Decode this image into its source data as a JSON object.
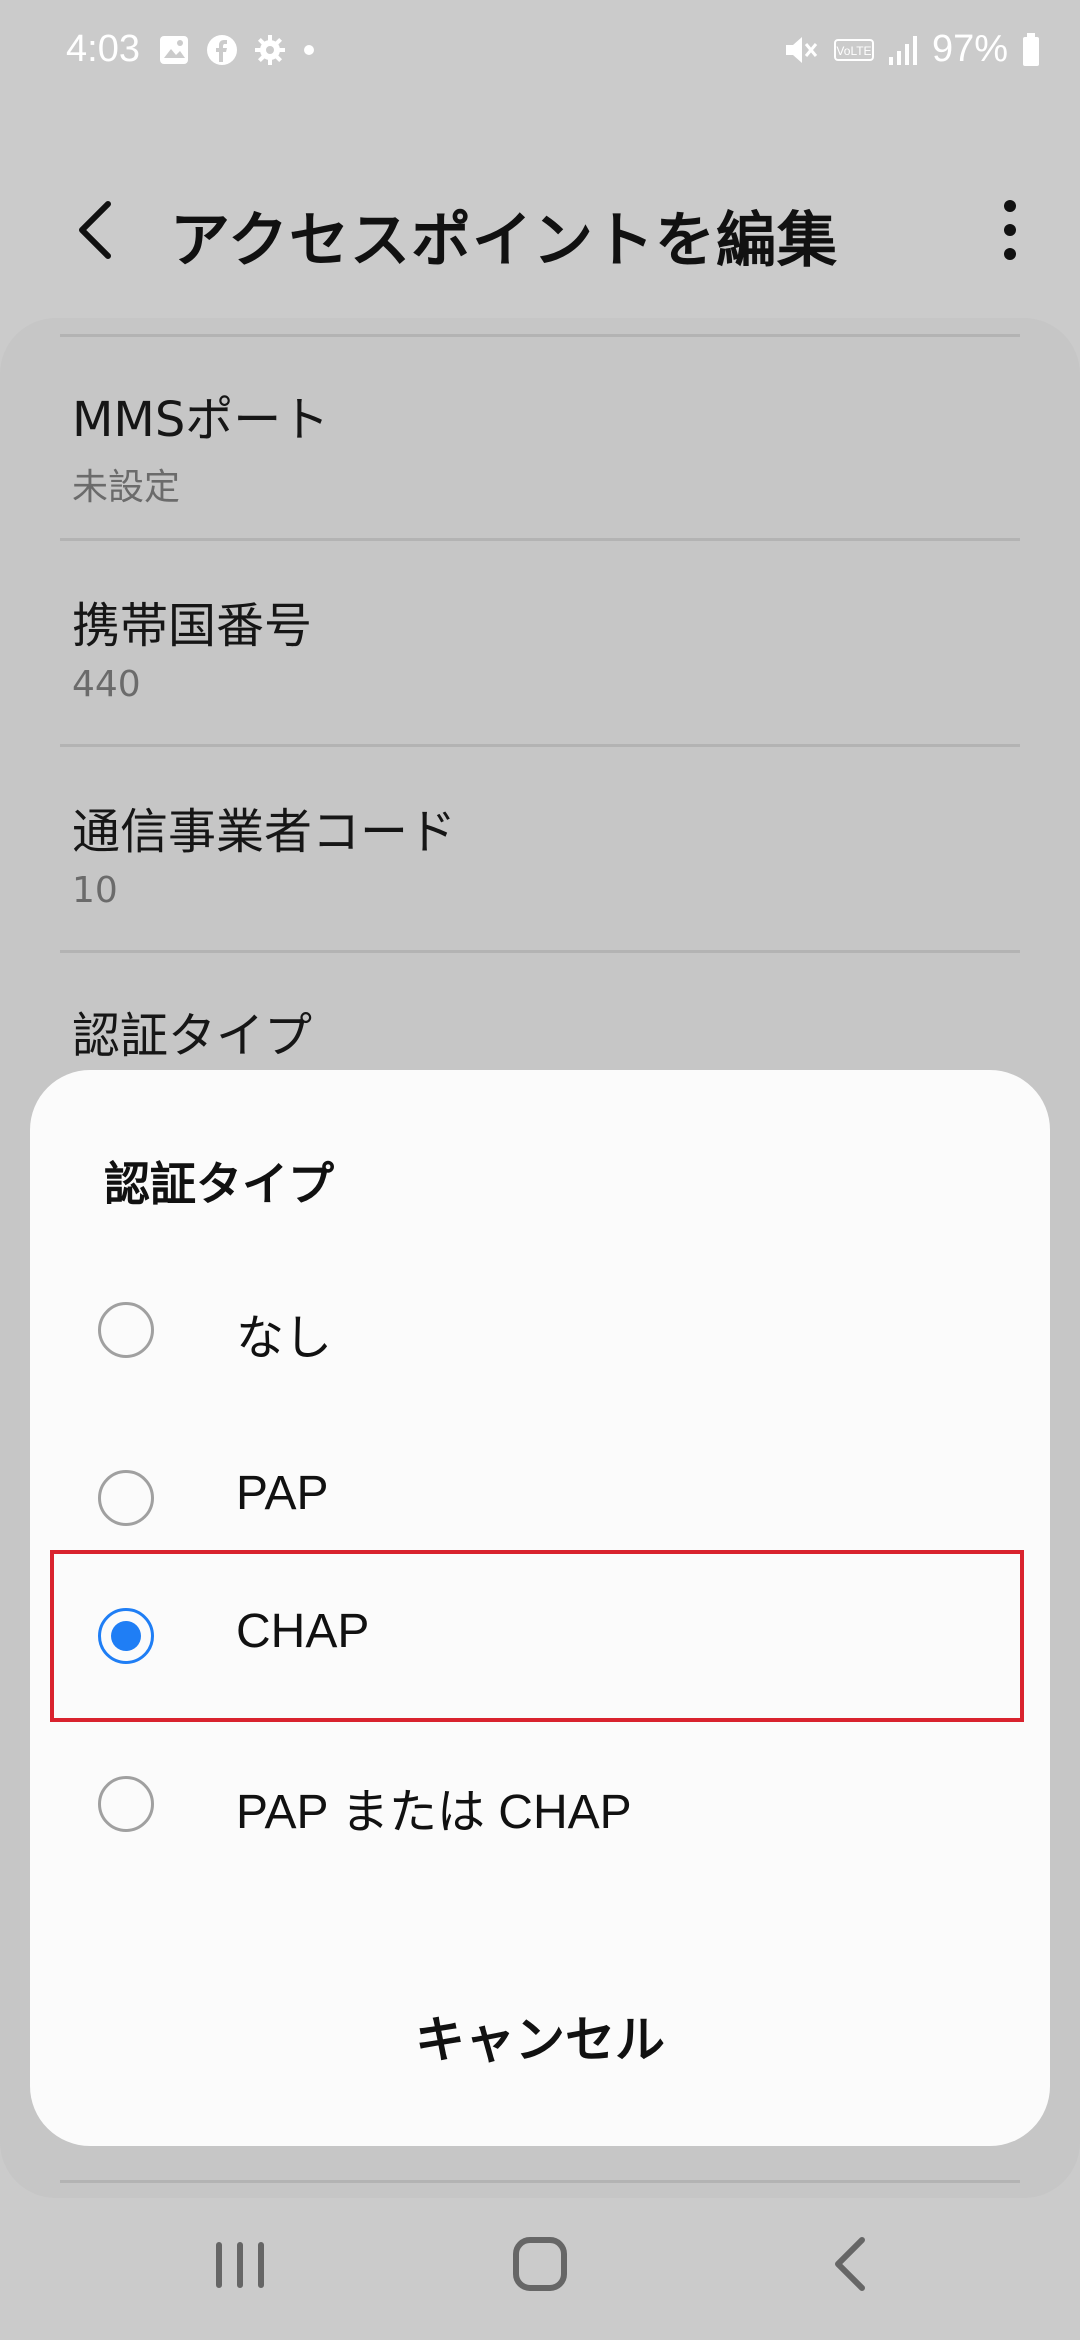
{
  "status_bar": {
    "time": "4:03",
    "battery": "97%",
    "left_icons": [
      "gallery-icon",
      "facebook-icon",
      "settings-gear-icon",
      "dot-icon"
    ],
    "right_icons": [
      "mute-icon",
      "volte-icon",
      "signal-icon",
      "battery-icon"
    ]
  },
  "header": {
    "title": "アクセスポイントを編集"
  },
  "settings": [
    {
      "title": "MMSポート",
      "value": "未設定"
    },
    {
      "title": "携帯国番号",
      "value": "440"
    },
    {
      "title": "通信事業者コード",
      "value": "10"
    },
    {
      "title": "認証タイプ"
    }
  ],
  "dialog": {
    "title": "認証タイプ",
    "options": [
      {
        "label": "なし",
        "checked": false
      },
      {
        "label": "PAP",
        "checked": false
      },
      {
        "label": "CHAP",
        "checked": true
      },
      {
        "label": "PAP または CHAP",
        "checked": false
      }
    ],
    "cancel": "キャンセル"
  },
  "colors": {
    "accent": "#1f7ef5",
    "highlight": "#d9232e"
  }
}
